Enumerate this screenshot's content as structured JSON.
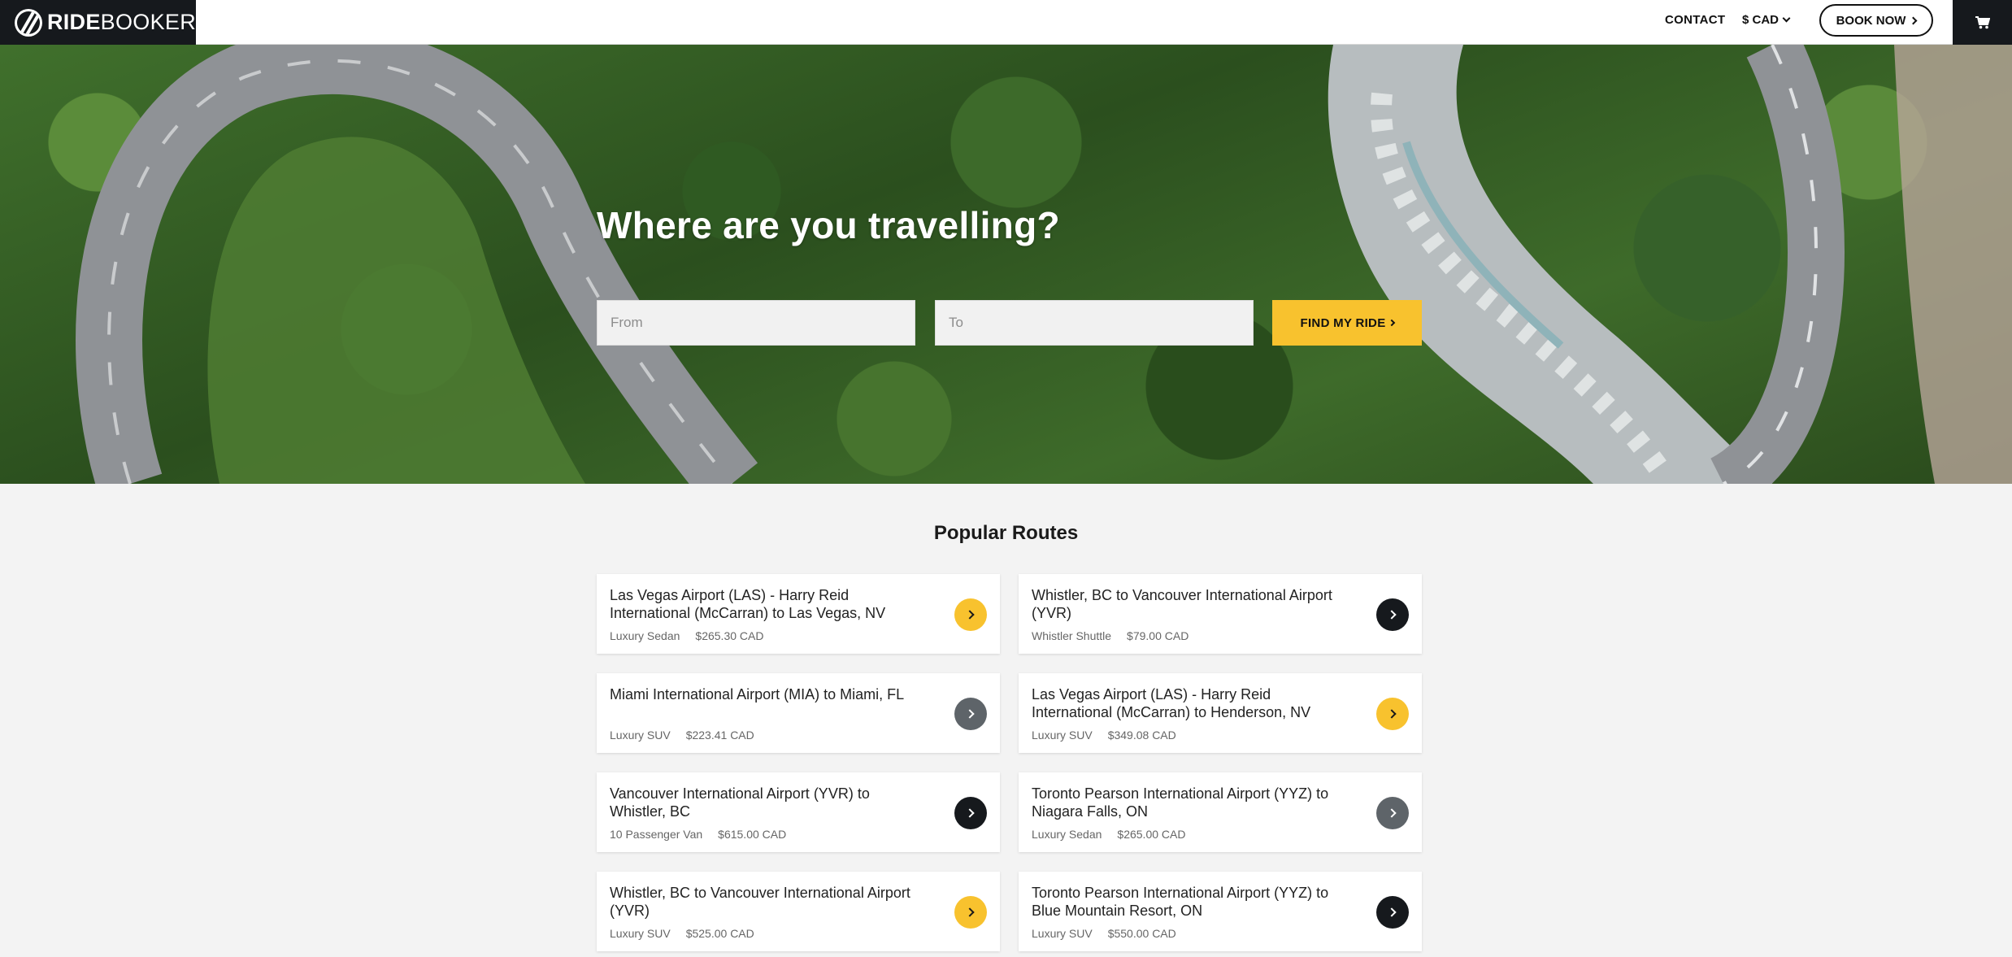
{
  "header": {
    "logo_bold": "RIDE",
    "logo_light": "BOOKER",
    "contact_label": "CONTACT",
    "currency_label": "$ CAD",
    "book_now_label": "BOOK NOW"
  },
  "hero": {
    "title": "Where are you travelling?",
    "from_placeholder": "From",
    "to_placeholder": "To",
    "find_label": "FIND MY RIDE"
  },
  "routes": {
    "title": "Popular Routes",
    "items": [
      {
        "title": "Las Vegas Airport (LAS) - Harry Reid International (McCarran) to Las Vegas, NV",
        "vehicle": "Luxury Sedan",
        "price": "$265.30 CAD",
        "button_color": "#f8c22e",
        "chevron_color": "#1a1a1a"
      },
      {
        "title": "Whistler, BC to Vancouver International Airport (YVR)",
        "vehicle": "Whistler Shuttle",
        "price": "$79.00 CAD",
        "button_color": "#16191d",
        "chevron_color": "#ffffff"
      },
      {
        "title": "Miami International Airport (MIA) to Miami, FL",
        "vehicle": "Luxury SUV",
        "price": "$223.41 CAD",
        "button_color": "#5e6469",
        "chevron_color": "#ffffff"
      },
      {
        "title": "Las Vegas Airport (LAS) - Harry Reid International (McCarran) to Henderson, NV",
        "vehicle": "Luxury SUV",
        "price": "$349.08 CAD",
        "button_color": "#f8c22e",
        "chevron_color": "#1a1a1a"
      },
      {
        "title": "Vancouver International Airport (YVR) to Whistler, BC",
        "vehicle": "10 Passenger Van",
        "price": "$615.00 CAD",
        "button_color": "#16191d",
        "chevron_color": "#ffffff"
      },
      {
        "title": "Toronto Pearson International Airport (YYZ) to Niagara Falls, ON",
        "vehicle": "Luxury Sedan",
        "price": "$265.00 CAD",
        "button_color": "#5e6469",
        "chevron_color": "#ffffff"
      },
      {
        "title": "Whistler, BC to Vancouver International Airport (YVR)",
        "vehicle": "Luxury SUV",
        "price": "$525.00 CAD",
        "button_color": "#f8c22e",
        "chevron_color": "#1a1a1a"
      },
      {
        "title": "Toronto Pearson International Airport (YYZ) to Blue Mountain Resort, ON",
        "vehicle": "Luxury SUV",
        "price": "$550.00 CAD",
        "button_color": "#16191d",
        "chevron_color": "#ffffff"
      }
    ]
  },
  "icons": {
    "logo": "ridebooker-logo-icon",
    "cart": "cart-icon",
    "chevron": "chevron-right-icon",
    "dropdown": "chevron-down-icon"
  }
}
